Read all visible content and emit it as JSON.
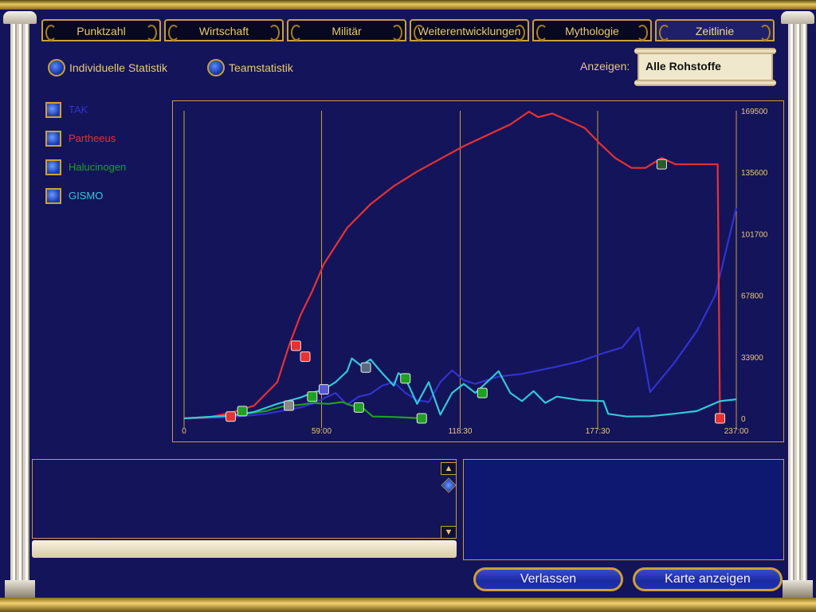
{
  "tabs": [
    {
      "label": "Punktzahl"
    },
    {
      "label": "Wirtschaft"
    },
    {
      "label": "Militär"
    },
    {
      "label": "Weiterentwicklungen"
    },
    {
      "label": "Mythologie"
    },
    {
      "label": "Zeitlinie",
      "active": true
    }
  ],
  "stat_mode": {
    "individual": "Individuelle Statistik",
    "team": "Teamstatistik",
    "selected": "individual"
  },
  "show": {
    "label": "Anzeigen:",
    "value": "Alle Rohstoffe"
  },
  "players": [
    {
      "name": "TAK",
      "color": "#3232d0"
    },
    {
      "name": "Partheeus",
      "color": "#e63232"
    },
    {
      "name": "Halucinogen",
      "color": "#20a020"
    },
    {
      "name": "GISMO",
      "color": "#32c8d8"
    }
  ],
  "chart_data": {
    "type": "line",
    "x_ticks": [
      "0",
      "59:00",
      "118:30",
      "177:30",
      "237:00"
    ],
    "y_ticks": [
      "169500",
      "135600",
      "101700",
      "67800",
      "33900",
      "0"
    ],
    "xlim": [
      0,
      237
    ],
    "ylim": [
      0,
      169500
    ],
    "grid": "vertical",
    "series": [
      {
        "name": "TAK",
        "color": "#3232d0",
        "points": [
          [
            0,
            0
          ],
          [
            20,
            500
          ],
          [
            35,
            2500
          ],
          [
            50,
            6000
          ],
          [
            55,
            8000
          ],
          [
            60,
            11000
          ],
          [
            65,
            14000
          ],
          [
            70,
            7500
          ],
          [
            75,
            12000
          ],
          [
            80,
            13500
          ],
          [
            85,
            18000
          ],
          [
            90,
            20000
          ],
          [
            95,
            14000
          ],
          [
            100,
            10000
          ],
          [
            105,
            9000
          ],
          [
            110,
            20000
          ],
          [
            115,
            26500
          ],
          [
            120,
            21000
          ],
          [
            125,
            19000
          ],
          [
            135,
            23000
          ],
          [
            145,
            24500
          ],
          [
            160,
            28500
          ],
          [
            170,
            31500
          ],
          [
            180,
            36000
          ],
          [
            188,
            39000
          ],
          [
            195,
            50000
          ],
          [
            200,
            14500
          ],
          [
            210,
            30000
          ],
          [
            220,
            48000
          ],
          [
            228,
            68000
          ],
          [
            237,
            116000
          ]
        ]
      },
      {
        "name": "Partheeus",
        "color": "#e63232",
        "points": [
          [
            0,
            0
          ],
          [
            10,
            500
          ],
          [
            20,
            3000
          ],
          [
            30,
            7000
          ],
          [
            40,
            20000
          ],
          [
            45,
            40000
          ],
          [
            50,
            57000
          ],
          [
            55,
            70000
          ],
          [
            60,
            85000
          ],
          [
            70,
            105000
          ],
          [
            80,
            118000
          ],
          [
            90,
            128000
          ],
          [
            100,
            136000
          ],
          [
            110,
            143000
          ],
          [
            120,
            150000
          ],
          [
            130,
            156000
          ],
          [
            140,
            162000
          ],
          [
            148,
            169000
          ],
          [
            152,
            166000
          ],
          [
            158,
            168000
          ],
          [
            165,
            164000
          ],
          [
            172,
            160000
          ],
          [
            178,
            152000
          ],
          [
            185,
            143500
          ],
          [
            192,
            138000
          ],
          [
            198,
            138000
          ],
          [
            205,
            143500
          ],
          [
            211,
            140000
          ],
          [
            218,
            140000
          ],
          [
            229,
            140000
          ],
          [
            230,
            0
          ]
        ]
      },
      {
        "name": "Halucinogen",
        "color": "#20a020",
        "points": [
          [
            0,
            0
          ],
          [
            20,
            1500
          ],
          [
            35,
            4000
          ],
          [
            42,
            6500
          ],
          [
            50,
            7500
          ],
          [
            55,
            8500
          ],
          [
            62,
            8000
          ],
          [
            68,
            9000
          ],
          [
            72,
            7000
          ],
          [
            76,
            6500
          ],
          [
            81,
            1000
          ],
          [
            90,
            800
          ],
          [
            96,
            400
          ],
          [
            102,
            0
          ]
        ]
      },
      {
        "name": "GISMO",
        "color": "#32c8d8",
        "points": [
          [
            0,
            0
          ],
          [
            20,
            1500
          ],
          [
            30,
            3500
          ],
          [
            40,
            8000
          ],
          [
            50,
            11500
          ],
          [
            55,
            14000
          ],
          [
            60,
            16000
          ],
          [
            65,
            20000
          ],
          [
            70,
            26000
          ],
          [
            72,
            33000
          ],
          [
            76,
            29000
          ],
          [
            80,
            32500
          ],
          [
            85,
            25000
          ],
          [
            90,
            18000
          ],
          [
            92,
            25000
          ],
          [
            95,
            22000
          ],
          [
            100,
            8000
          ],
          [
            105,
            20000
          ],
          [
            110,
            2000
          ],
          [
            115,
            14000
          ],
          [
            120,
            19000
          ],
          [
            125,
            14000
          ],
          [
            130,
            20000
          ],
          [
            135,
            26000
          ],
          [
            140,
            14000
          ],
          [
            145,
            9500
          ],
          [
            150,
            15000
          ],
          [
            155,
            8500
          ],
          [
            160,
            12000
          ],
          [
            170,
            10000
          ],
          [
            180,
            9500
          ],
          [
            182,
            2500
          ],
          [
            190,
            1000
          ],
          [
            200,
            1200
          ],
          [
            210,
            2500
          ],
          [
            220,
            4000
          ],
          [
            230,
            9500
          ],
          [
            237,
            10500
          ]
        ]
      }
    ]
  }
}
